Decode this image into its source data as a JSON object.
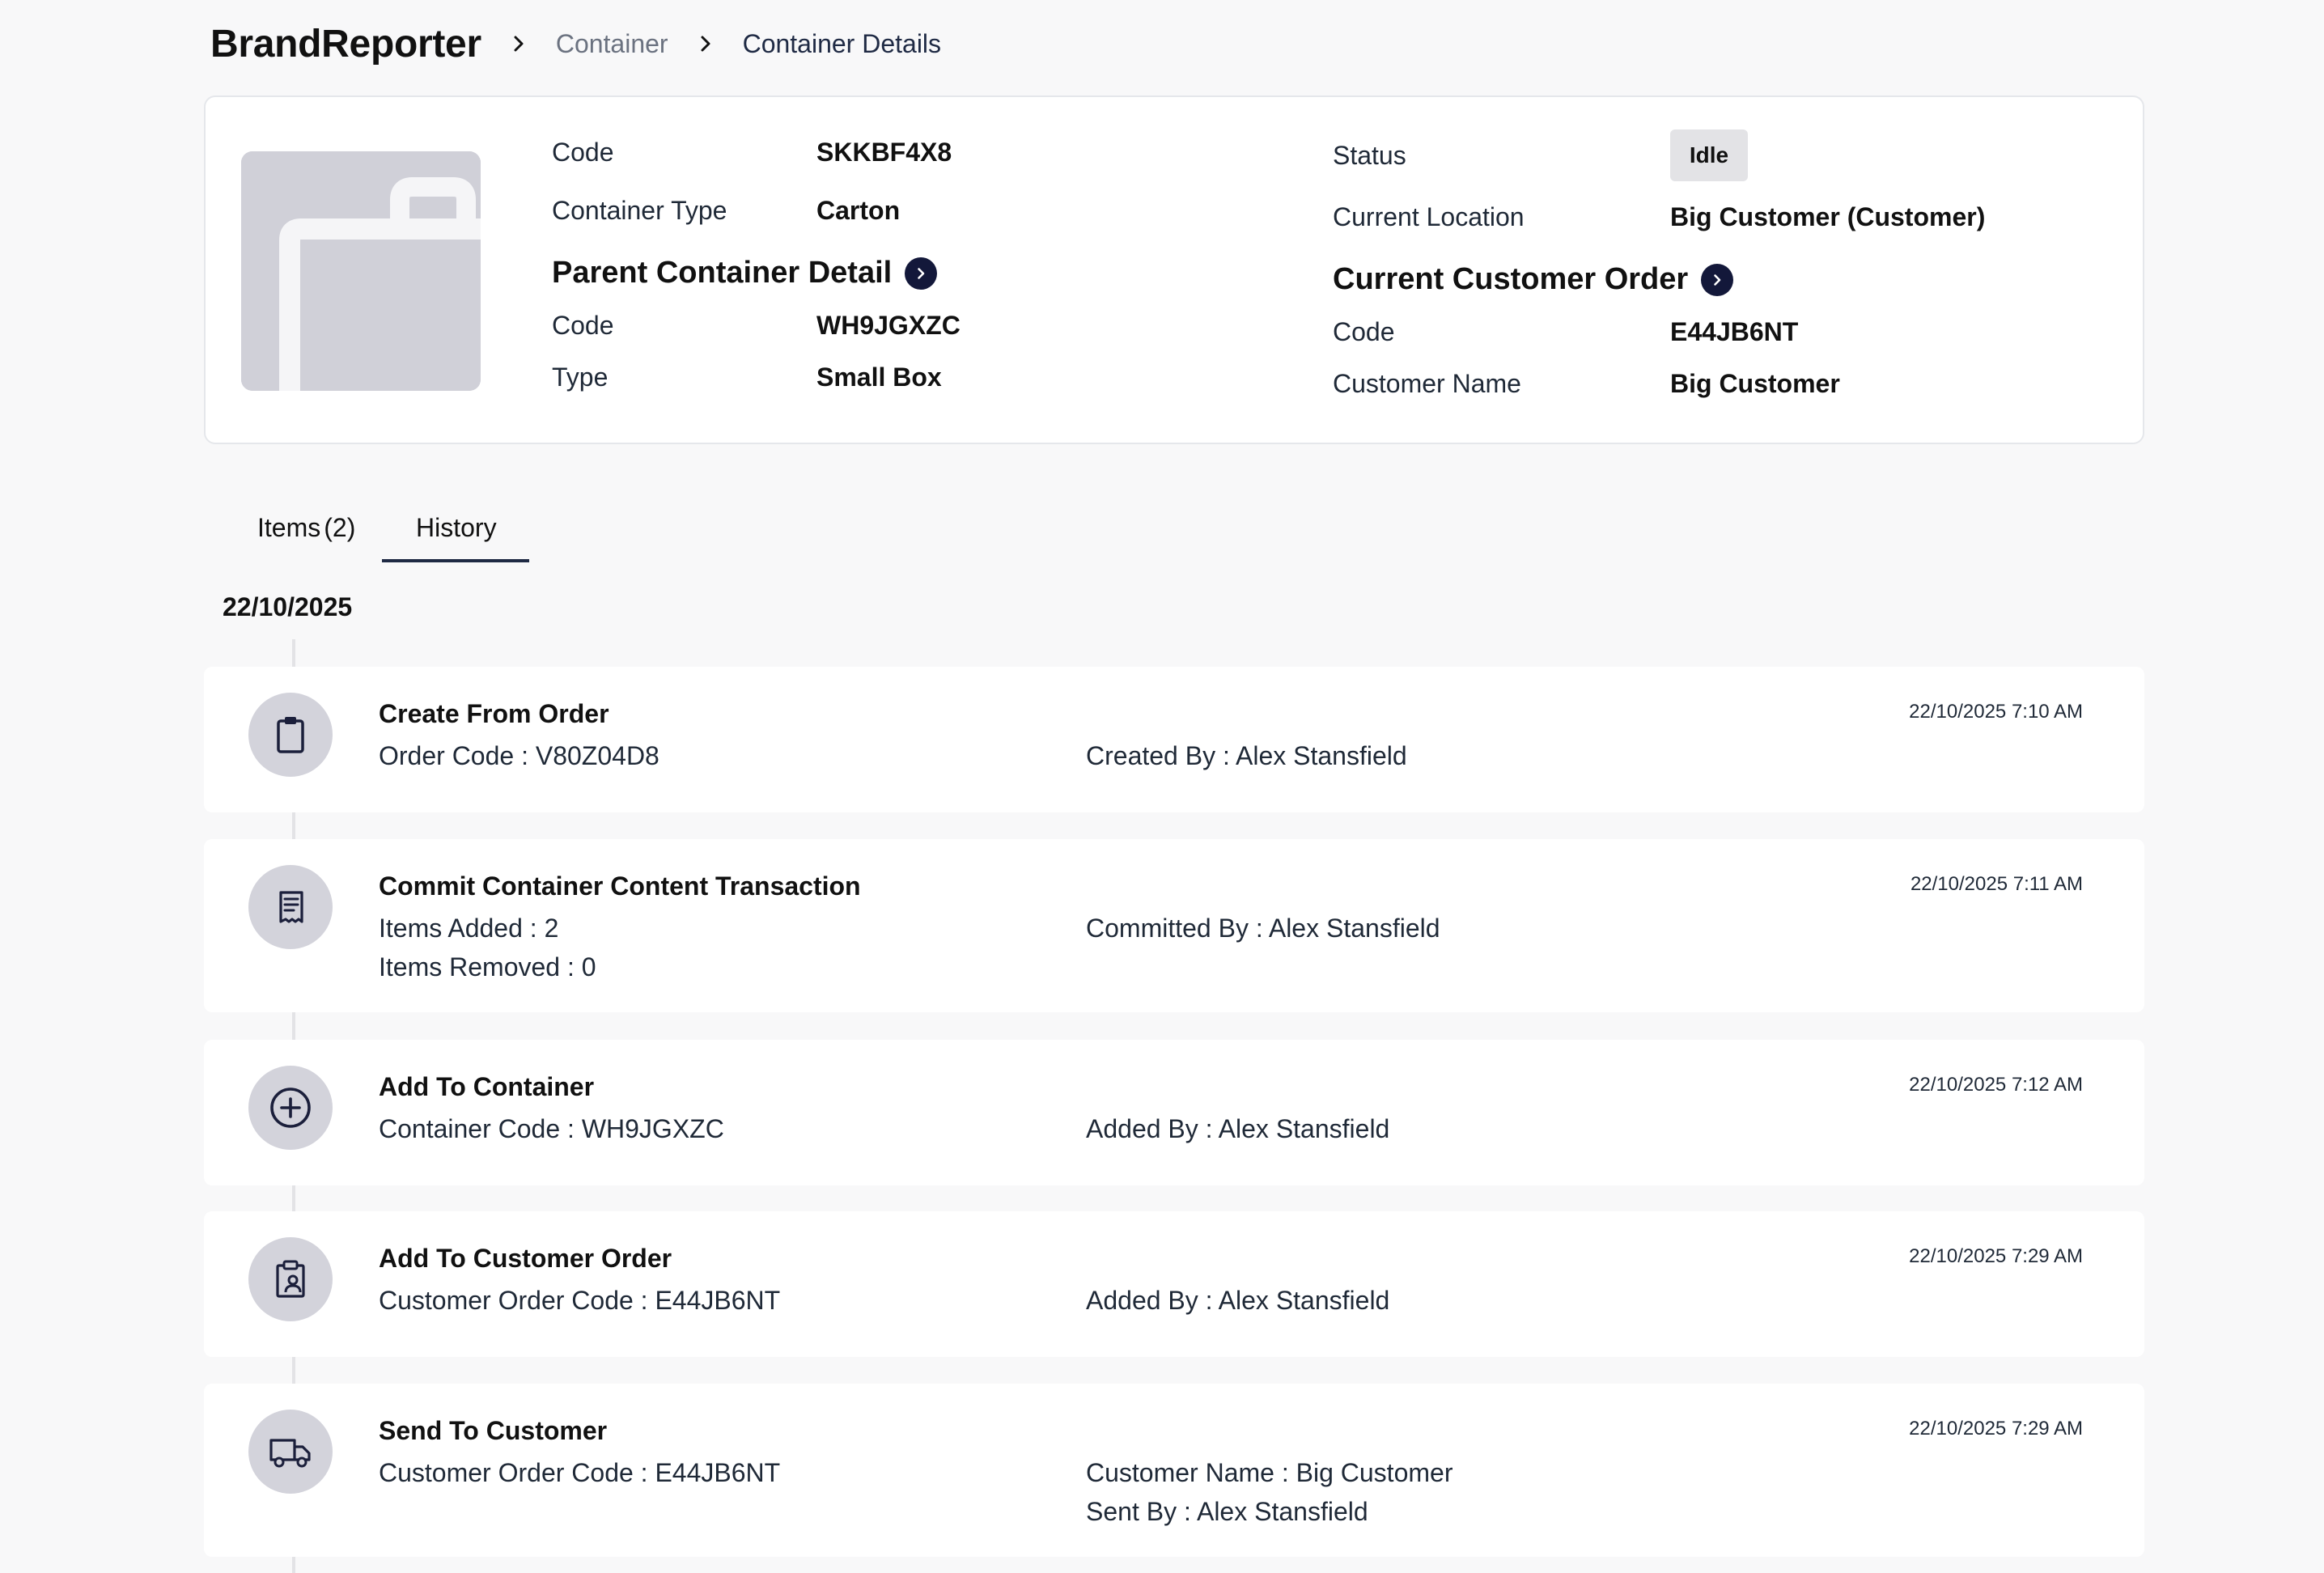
{
  "breadcrumb": {
    "brand": "BrandReporter",
    "items": [
      "Container",
      "Container Details"
    ]
  },
  "container": {
    "code_label": "Code",
    "code": "SKKBF4X8",
    "type_label": "Container Type",
    "type": "Carton",
    "status_label": "Status",
    "status": "Idle",
    "location_label": "Current Location",
    "location": "Big Customer (Customer)",
    "parent": {
      "heading": "Parent Container Detail",
      "code_label": "Code",
      "code": "WH9JGXZC",
      "type_label": "Type",
      "type": "Small Box"
    },
    "order": {
      "heading": "Current Customer Order",
      "code_label": "Code",
      "code": "E44JB6NT",
      "name_label": "Customer Name",
      "name": "Big Customer"
    }
  },
  "tabs": [
    {
      "label": "Items",
      "count": "(2)",
      "active": false
    },
    {
      "label": "History",
      "active": true
    }
  ],
  "history": {
    "date": "22/10/2025",
    "events": [
      {
        "icon": "clipboard-icon",
        "title": "Create From Order",
        "left_lines": [
          "Order Code : V80Z04D8"
        ],
        "right_lines": [
          "Created By : Alex Stansfield"
        ],
        "time": "22/10/2025 7:10 AM"
      },
      {
        "icon": "receipt-icon",
        "title": "Commit Container Content Transaction",
        "left_lines": [
          "Items Added : 2",
          "Items Removed : 0"
        ],
        "right_lines": [
          "Committed By : Alex Stansfield"
        ],
        "time": "22/10/2025 7:11 AM"
      },
      {
        "icon": "plus-circle-icon",
        "title": "Add To Container",
        "left_lines": [
          "Container Code : WH9JGXZC"
        ],
        "right_lines": [
          "Added By : Alex Stansfield"
        ],
        "time": "22/10/2025 7:12 AM"
      },
      {
        "icon": "clipboard-user-icon",
        "title": "Add To Customer Order",
        "left_lines": [
          "Customer Order Code : E44JB6NT"
        ],
        "right_lines": [
          "Added By : Alex Stansfield"
        ],
        "time": "22/10/2025 7:29 AM"
      },
      {
        "icon": "truck-icon",
        "title": "Send To Customer",
        "left_lines": [
          "Customer Order Code : E44JB6NT"
        ],
        "right_lines": [
          "Customer Name : Big Customer",
          "Sent By : Alex Stansfield"
        ],
        "time": "22/10/2025 7:29 AM"
      }
    ]
  }
}
